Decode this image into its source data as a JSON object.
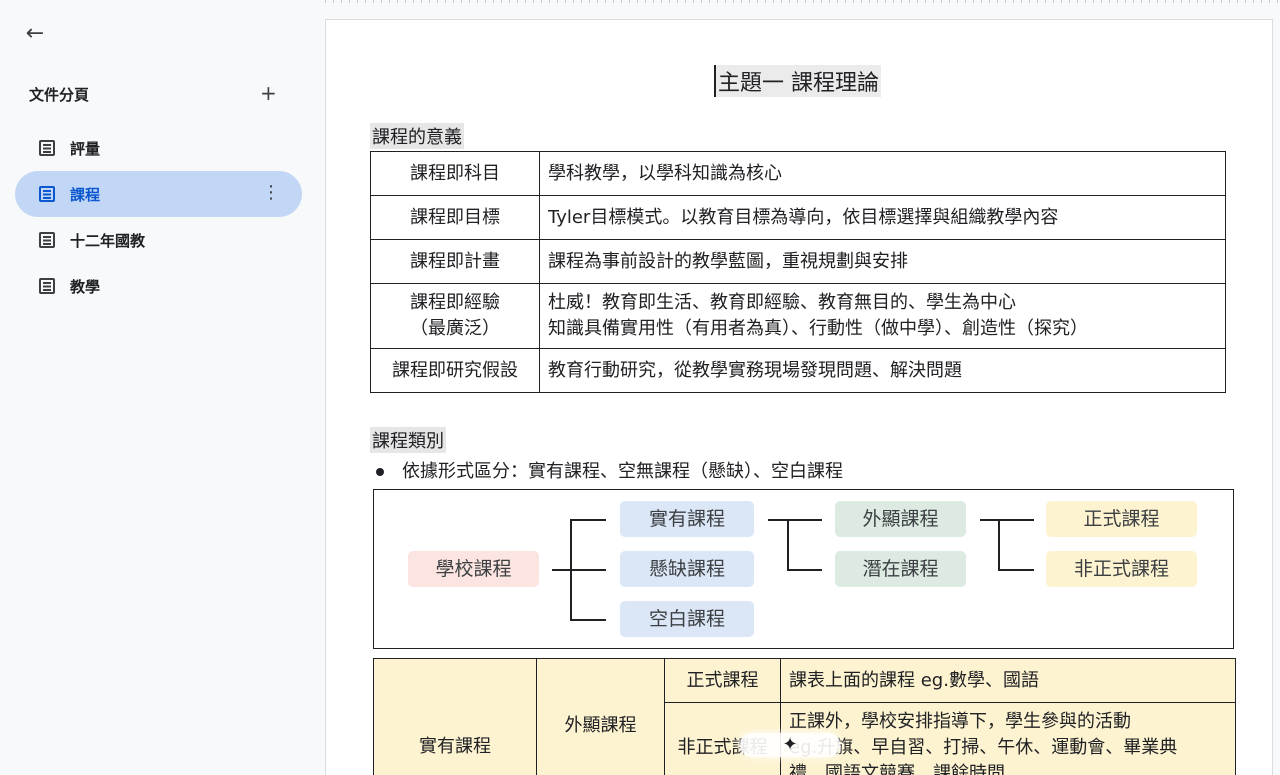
{
  "sidebar": {
    "back_icon": "arrow-left-icon",
    "title": "文件分頁",
    "add_label": "+",
    "items": [
      {
        "label": "評量",
        "active": false
      },
      {
        "label": "課程",
        "active": true
      },
      {
        "label": "十二年國教",
        "active": false
      },
      {
        "label": "教學",
        "active": false
      }
    ],
    "more_label": "⋮"
  },
  "doc": {
    "title": "主題一 課程理論",
    "section1": "課程的意義",
    "table1": [
      {
        "key": "課程即科目",
        "value": "學科教學，以學科知識為核心"
      },
      {
        "key": "課程即目標",
        "value": "Tyler目標模式。以教育目標為導向，依目標選擇與組織教學內容"
      },
      {
        "key": "課程即計畫",
        "value": "課程為事前設計的教學藍圖，重視規劃與安排"
      },
      {
        "key": "課程即經驗",
        "key2": "（最廣泛）",
        "value": "杜威！教育即生活、教育即經驗、教育無目的、學生為中心",
        "value2": "知識具備實用性（有用者為真）、行動性（做中學）、創造性（探究）"
      },
      {
        "key": "課程即研究假設",
        "value": "教育行動研究，從教學實務現場發現問題、解決問題"
      }
    ],
    "section2": "課程類別",
    "bullet": "依據形式區分：實有課程、空無課程（懸缺）、空白課程",
    "diagram": {
      "root": "學校課程",
      "level1": [
        "實有課程",
        "懸缺課程",
        "空白課程"
      ],
      "level2": [
        "外顯課程",
        "潛在課程"
      ],
      "level3": [
        "正式課程",
        "非正式課程"
      ]
    },
    "table2": {
      "c1": "實有課程",
      "c2": "外顯課程",
      "r1_type": "正式課程",
      "r1_desc": "課表上面的課程 eg.數學、國語",
      "r2_type": "非正式課程",
      "r2_desc_line1": "正課外，學校安排指導下，學生參與的活動",
      "r2_desc_line2": "eg.升旗、早自習、打掃、午休、運動會、畢業典",
      "r2_desc_line3": "禮、國語文競賽、課餘時間"
    }
  },
  "overlay": {
    "sparkle": "✦"
  }
}
